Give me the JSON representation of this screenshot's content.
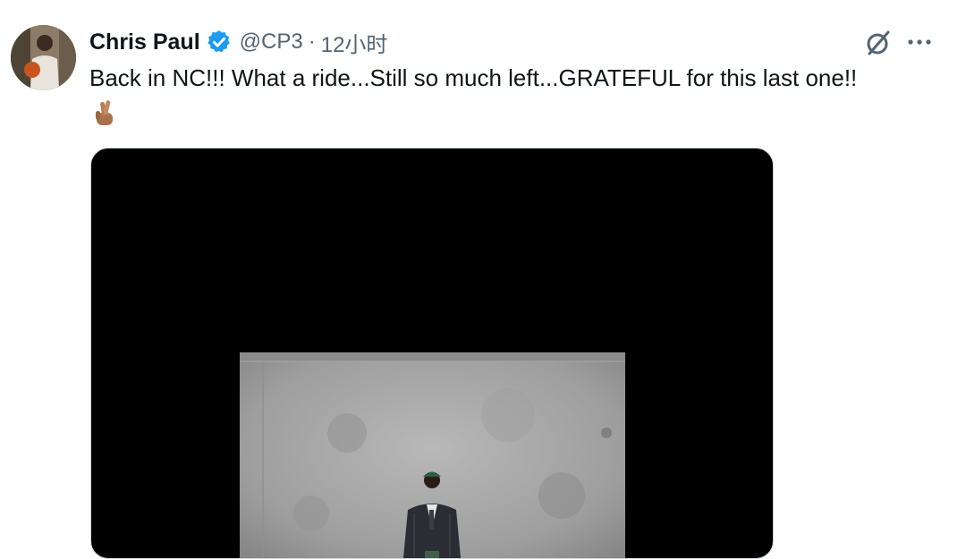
{
  "tweet": {
    "author_name": "Chris Paul",
    "handle": "@CP3",
    "separator": "·",
    "timestamp": "12小时",
    "verified_icon": "verified-badge-icon",
    "text": "Back in NC!!! What a ride...Still so much left...GRATEFUL for this last one!!",
    "emoji": "crossed-fingers-emoji",
    "actions": [
      "grok-icon",
      "more-icon"
    ],
    "colors": {
      "text": "#0f1419",
      "secondary": "#536471",
      "verified": "#1d9bf0",
      "media_background": "#000000"
    }
  }
}
